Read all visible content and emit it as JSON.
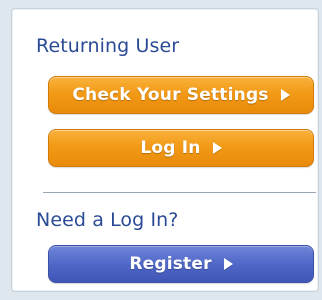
{
  "returning": {
    "heading": "Returning User",
    "check_settings_label": "Check Your Settings",
    "login_label": "Log In"
  },
  "new_user": {
    "heading": "Need a Log In?",
    "register_label": "Register"
  },
  "colors": {
    "heading_text": "#2b4a95",
    "orange_button": "#f29a17",
    "blue_button": "#5068c8",
    "background": "#dfe7ee"
  },
  "icons": {
    "button_arrow": "play-arrow-icon"
  }
}
